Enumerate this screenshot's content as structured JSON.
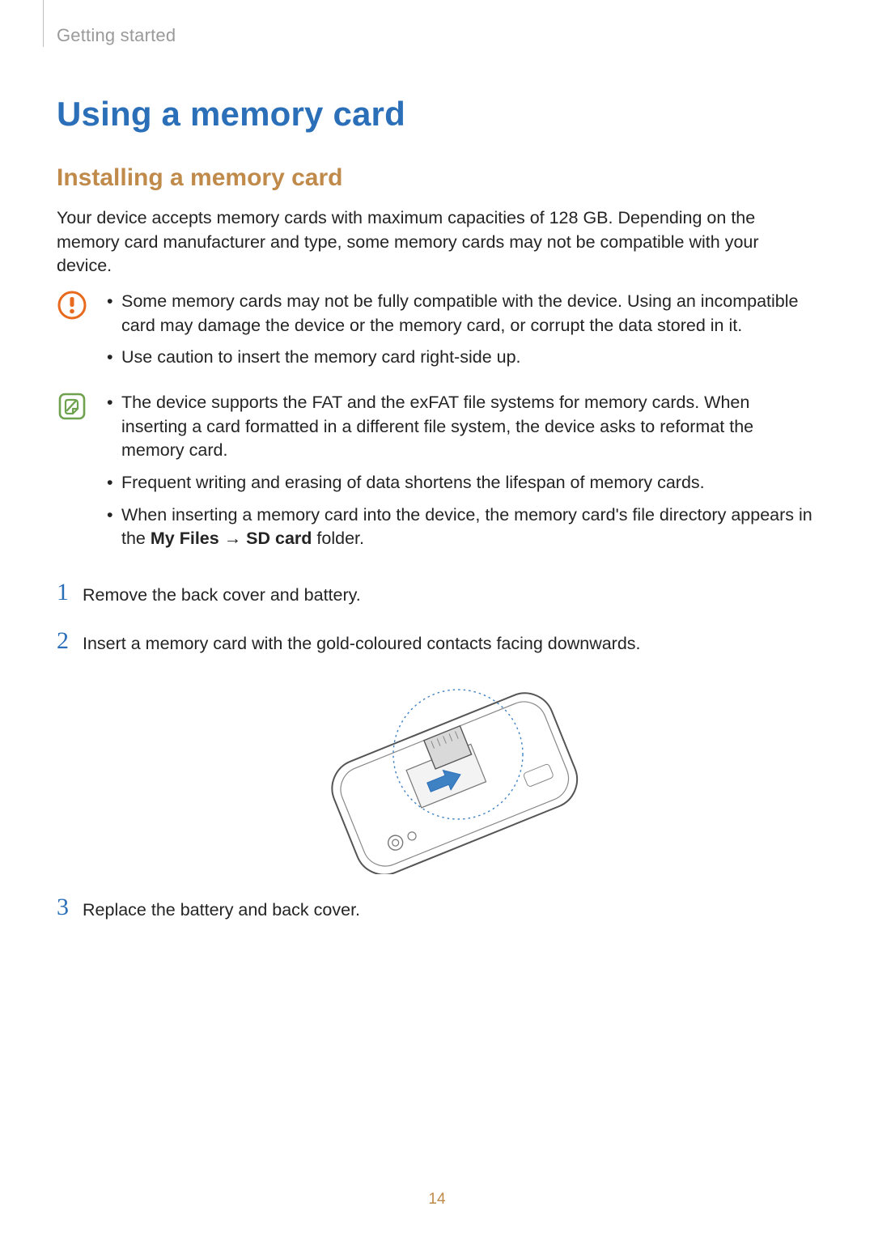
{
  "header": {
    "section": "Getting started"
  },
  "title": "Using a memory card",
  "subheading": "Installing a memory card",
  "intro": "Your device accepts memory cards with maximum capacities of 128 GB. Depending on the memory card manufacturer and type, some memory cards may not be compatible with your device.",
  "callout_warning": {
    "items": [
      "Some memory cards may not be fully compatible with the device. Using an incompatible card may damage the device or the memory card, or corrupt the data stored in it.",
      "Use caution to insert the memory card right-side up."
    ]
  },
  "callout_note": {
    "items": [
      "The device supports the FAT and the exFAT file systems for memory cards. When inserting a card formatted in a different file system, the device asks to reformat the memory card.",
      "Frequent writing and erasing of data shortens the lifespan of memory cards."
    ],
    "item_prefix": "When inserting a memory card into the device, the memory card's file directory appears in the ",
    "item_bold1": "My Files",
    "item_arrow": " → ",
    "item_bold2": "SD card",
    "item_suffix": " folder."
  },
  "steps": [
    {
      "num": "1",
      "text": "Remove the back cover and battery."
    },
    {
      "num": "2",
      "text": "Insert a memory card with the gold-coloured contacts facing downwards."
    },
    {
      "num": "3",
      "text": "Replace the battery and back cover."
    }
  ],
  "page_number": "14"
}
